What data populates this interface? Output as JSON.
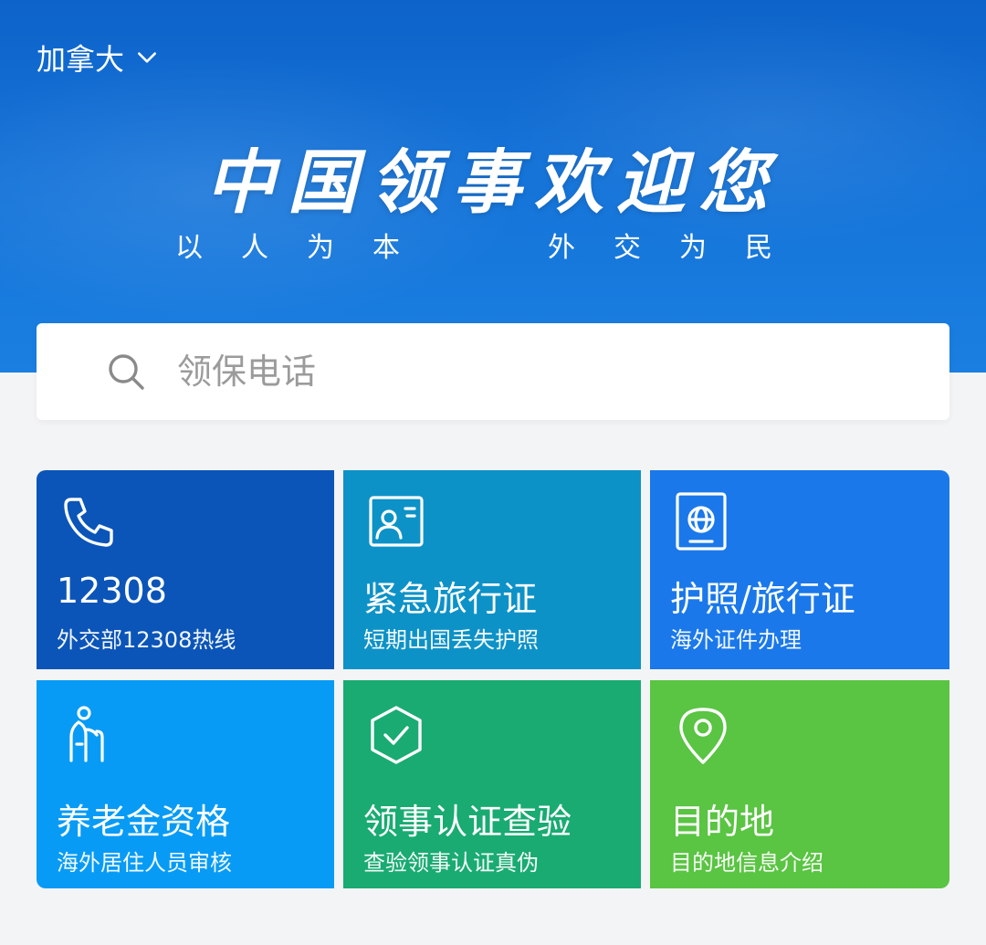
{
  "header": {
    "region": "加拿大",
    "slogan_main": "中国领事欢迎您",
    "slogan_sub_left": "以人为本",
    "slogan_sub_right": "外交为民"
  },
  "search": {
    "placeholder": "领保电话"
  },
  "services": [
    {
      "title": "12308",
      "desc": "外交部12308热线",
      "icon": "phone-icon",
      "color": "#0b55b8"
    },
    {
      "title": "紧急旅行证",
      "desc": "短期出国丢失护照",
      "icon": "id-card-icon",
      "color": "#0d92c7"
    },
    {
      "title": "护照/旅行证",
      "desc": "海外证件办理",
      "icon": "passport-icon",
      "color": "#1a78ea"
    },
    {
      "title": "养老金资格",
      "desc": "海外居住人员审核",
      "icon": "elderly-person-icon",
      "color": "#079bf5"
    },
    {
      "title": "领事认证查验",
      "desc": "查验领事认证真伪",
      "icon": "shield-check-icon",
      "color": "#19ab72"
    },
    {
      "title": "目的地",
      "desc": "目的地信息介绍",
      "icon": "location-pin-icon",
      "color": "#5ac443"
    }
  ]
}
